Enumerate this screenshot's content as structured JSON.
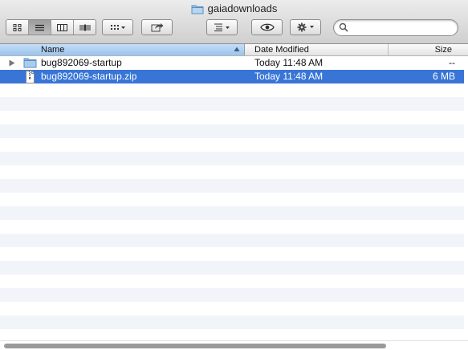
{
  "window": {
    "title": "gaiadownloads",
    "title_icon": "folder-icon"
  },
  "toolbar": {
    "view_modes": [
      {
        "name": "icon-view",
        "icon": "grid-icon",
        "active": false
      },
      {
        "name": "list-view",
        "icon": "list-icon",
        "active": true
      },
      {
        "name": "column-view",
        "icon": "columns-icon",
        "active": false
      },
      {
        "name": "coverflow-view",
        "icon": "coverflow-icon",
        "active": false
      }
    ],
    "arrange_icon": "arrange-grid-icon",
    "share_icon": "share-icon",
    "arrange_by_icon": "arrange-list-icon",
    "quicklook_icon": "eye-icon",
    "action_icon": "gear-icon",
    "search": {
      "placeholder": "",
      "value": "",
      "icon": "magnifier-icon"
    }
  },
  "columns": {
    "name": "Name",
    "date": "Date Modified",
    "size": "Size",
    "sorted_by": "name"
  },
  "files": [
    {
      "name": "bug892069-startup",
      "date": "Today 11:48 AM",
      "size": "--",
      "kind": "folder",
      "expandable": true,
      "selected": false
    },
    {
      "name": "bug892069-startup.zip",
      "date": "Today 11:48 AM",
      "size": "6 MB",
      "kind": "zip",
      "expandable": false,
      "selected": true
    }
  ],
  "colors": {
    "selection": "#3875d7",
    "stripe": "#f1f5fa",
    "sorted_column": "#9ac3ec"
  }
}
